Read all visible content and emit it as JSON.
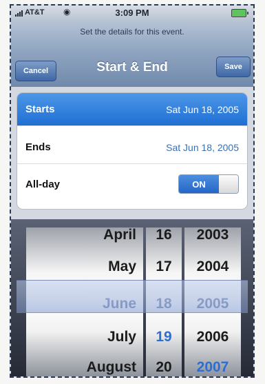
{
  "status": {
    "carrier": "AT&T",
    "time": "3:09 PM"
  },
  "nav": {
    "prompt": "Set the details for this event.",
    "title": "Start & End",
    "cancel_label": "Cancel",
    "save_label": "Save"
  },
  "rows": {
    "starts": {
      "label": "Starts",
      "value": "Sat Jun 18, 2005"
    },
    "ends": {
      "label": "Ends",
      "value": "Sat Jun 18, 2005"
    },
    "allday": {
      "label": "All-day",
      "toggle": "ON"
    }
  },
  "picker": {
    "months": [
      "April",
      "May",
      "June",
      "July",
      "August"
    ],
    "days": [
      "16",
      "17",
      "18",
      "19",
      "20"
    ],
    "years": [
      "2003",
      "2004",
      "2005",
      "2006",
      "2007"
    ]
  },
  "colors": {
    "accent": "#2d6fd1",
    "nav": "#7089ab"
  }
}
